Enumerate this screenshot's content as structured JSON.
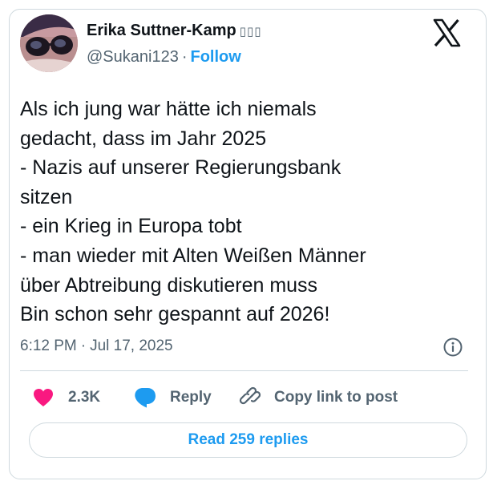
{
  "author": {
    "name": "Erika Suttner-Kamp",
    "name_emoji": "▯▯▯",
    "handle": "@Sukani123",
    "separator": "·",
    "follow_label": "Follow"
  },
  "tweet": {
    "lines": [
      "Als ich jung war hätte ich niemals",
      "gedacht, dass im Jahr 2025",
      "- Nazis auf unserer Regierungsbank",
      "sitzen",
      "- ein Krieg in Europa tobt",
      "- man wieder mit Alten Weißen Männer",
      "über Abtreibung diskutieren muss",
      "Bin schon sehr gespannt auf 2026!"
    ],
    "time": "6:12 PM",
    "separator": "·",
    "date": "Jul 17, 2025"
  },
  "actions": {
    "like_count": "2.3K",
    "reply_label": "Reply",
    "copy_link_label": "Copy link to post",
    "read_replies_label": "Read 259 replies"
  },
  "icons": {
    "brand": "x-logo-icon",
    "info": "info-icon",
    "like": "heart-icon",
    "reply": "speech-bubble-icon",
    "copy": "link-icon"
  },
  "colors": {
    "accent": "#1d9bf0",
    "like": "#f91880",
    "secondary_text": "#536471",
    "border": "#cfd9de",
    "text": "#0f1419"
  }
}
